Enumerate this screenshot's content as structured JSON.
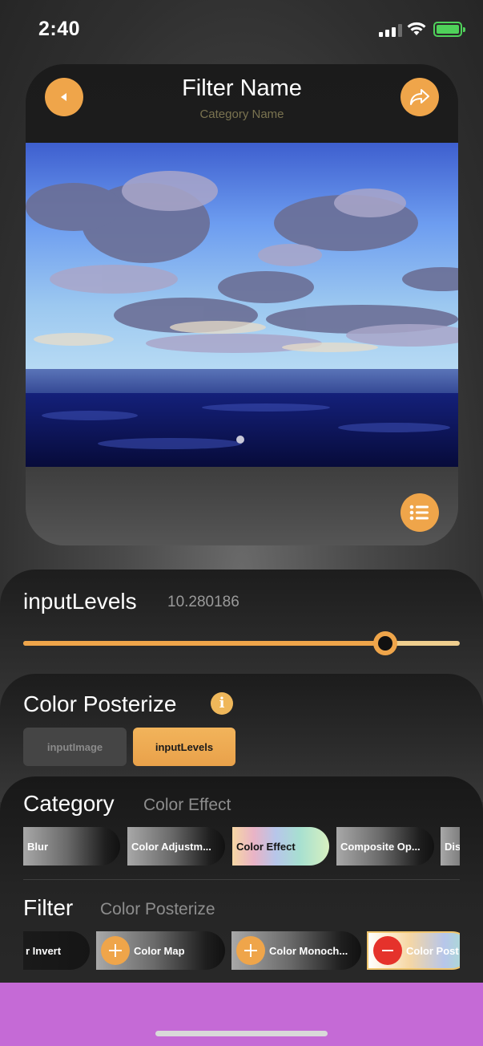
{
  "status": {
    "time": "2:40"
  },
  "preview": {
    "title": "Filter Name",
    "subtitle": "Category Name",
    "accent": "#efa54a",
    "icons": [
      "back-icon",
      "share-icon",
      "list-icon"
    ]
  },
  "parameter": {
    "name": "inputLevels",
    "value": "10.280186",
    "slider_fraction": 0.83
  },
  "inputs": {
    "title": "Color Posterize",
    "tabs": [
      {
        "label": "inputImage",
        "selected": false
      },
      {
        "label": "inputLevels",
        "selected": true
      }
    ]
  },
  "category": {
    "label": "Category",
    "value": "Color Effect",
    "chips": [
      {
        "label": "Blur",
        "selected": false
      },
      {
        "label": "Color Adjustm...",
        "selected": false
      },
      {
        "label": "Color Effect",
        "selected": true
      },
      {
        "label": "Composite Op...",
        "selected": false
      },
      {
        "label": "Dis",
        "selected": false
      }
    ]
  },
  "filter": {
    "label": "Filter",
    "value": "Color Posterize",
    "chips": [
      {
        "label": "r Invert",
        "action": "none"
      },
      {
        "label": "Color Map",
        "action": "add"
      },
      {
        "label": "Color Monoch...",
        "action": "add"
      },
      {
        "label": "Color Post",
        "action": "remove",
        "selected": true
      }
    ]
  },
  "colors": {
    "bottom_bar": "#c56ad6",
    "remove": "#e5322b"
  }
}
